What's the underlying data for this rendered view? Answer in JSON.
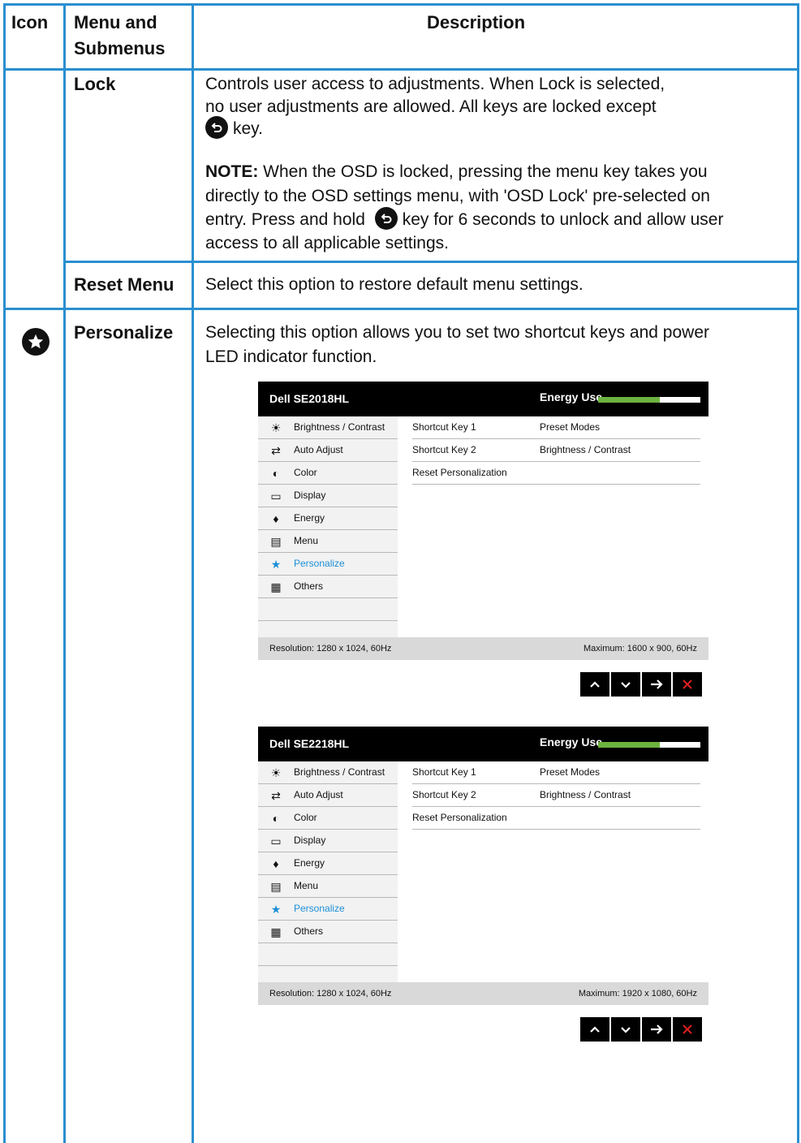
{
  "table": {
    "headers": {
      "icon": "Icon",
      "menu_line1": "Menu and",
      "menu_line2": "Submenus",
      "description": "Description"
    },
    "lock": {
      "name": "Lock",
      "desc_line1": "Controls user access to adjustments. When Lock is selected,",
      "desc_line2": "no user adjustments are allowed. All keys are locked except",
      "desc_line3_after_icon": "key.",
      "note_label": "NOTE:",
      "note_line1": " When the OSD is locked, pressing the menu key takes you",
      "note_line2": "directly to the OSD settings menu, with 'OSD Lock' pre-selected on",
      "note_line3_before": "entry. Press and hold",
      "note_line3_after": "key for 6 seconds to unlock and allow user",
      "note_line4": "access to all applicable settings."
    },
    "reset_menu": {
      "name": "Reset Menu",
      "desc": "Select this option to restore default menu settings."
    },
    "personalize": {
      "icon": "star-icon",
      "name": "Personalize",
      "desc_line1": "Selecting this option allows you to set two shortcut keys and power",
      "desc_line2": "LED indicator function."
    }
  },
  "osd_menus": [
    {
      "title": "Dell SE2018HL",
      "energy_label": "Energy Use",
      "energy_level": 0.6,
      "menu_items": [
        "Brightness / Contrast",
        "Auto Adjust",
        "Color",
        "Display",
        "Energy",
        "Menu",
        "Personalize",
        "Others"
      ],
      "selected": "Personalize",
      "rows": [
        {
          "key": "Shortcut Key 1",
          "value": "Preset Modes"
        },
        {
          "key": "Shortcut Key 2",
          "value": "Brightness / Contrast"
        },
        {
          "key": "Reset Personalization",
          "value": ""
        }
      ],
      "resolution": "Resolution: 1280 x 1024, 60Hz",
      "maximum": "Maximum: 1600 x 900, 60Hz"
    },
    {
      "title": "Dell SE2218HL",
      "energy_label": "Energy Use",
      "energy_level": 0.6,
      "menu_items": [
        "Brightness / Contrast",
        "Auto Adjust",
        "Color",
        "Display",
        "Energy",
        "Menu",
        "Personalize",
        "Others"
      ],
      "selected": "Personalize",
      "rows": [
        {
          "key": "Shortcut Key 1",
          "value": "Preset Modes"
        },
        {
          "key": "Shortcut Key 2",
          "value": "Brightness / Contrast"
        },
        {
          "key": "Reset Personalization",
          "value": ""
        }
      ],
      "resolution": "Resolution: 1280 x 1024, 60Hz",
      "maximum": "Maximum: 1920 x 1080, 60Hz"
    }
  ],
  "colors": {
    "border": "#2a8fd0",
    "selected": "#1b8fd6",
    "energy": "#6cb33f",
    "close": "#e02020"
  }
}
